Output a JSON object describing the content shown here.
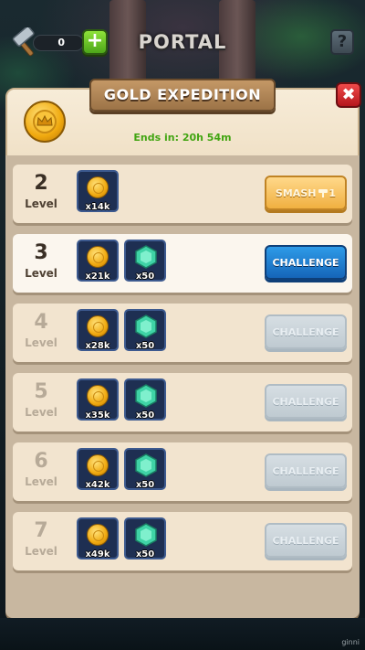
{
  "topbar": {
    "hammer_count": "0",
    "plus_label": "+",
    "title": "PORTAL",
    "help_label": "?"
  },
  "panel": {
    "title": "GOLD EXPEDITION",
    "close_label": "✖",
    "timer": "Ends in: 20h 54m"
  },
  "levels": [
    {
      "number": "2",
      "label": "Level",
      "rewards": [
        {
          "type": "coin",
          "amount": "x14k"
        }
      ],
      "button": "SMASH",
      "button_suffix": "1",
      "state": "completed"
    },
    {
      "number": "3",
      "label": "Level",
      "rewards": [
        {
          "type": "coin",
          "amount": "x21k"
        },
        {
          "type": "gem",
          "amount": "x50"
        }
      ],
      "button": "CHALLENGE",
      "state": "active"
    },
    {
      "number": "4",
      "label": "Level",
      "rewards": [
        {
          "type": "coin",
          "amount": "x28k"
        },
        {
          "type": "gem",
          "amount": "x50"
        }
      ],
      "button": "CHALLENGE",
      "state": "locked"
    },
    {
      "number": "5",
      "label": "Level",
      "rewards": [
        {
          "type": "coin",
          "amount": "x35k"
        },
        {
          "type": "gem",
          "amount": "x50"
        }
      ],
      "button": "CHALLENGE",
      "state": "locked"
    },
    {
      "number": "6",
      "label": "Level",
      "rewards": [
        {
          "type": "coin",
          "amount": "x42k"
        },
        {
          "type": "gem",
          "amount": "x50"
        }
      ],
      "button": "CHALLENGE",
      "state": "locked"
    },
    {
      "number": "7",
      "label": "Level",
      "rewards": [
        {
          "type": "coin",
          "amount": "x49k"
        },
        {
          "type": "gem",
          "amount": "x50"
        }
      ],
      "button": "CHALLENGE",
      "state": "locked"
    }
  ],
  "footer": {
    "tag": "ginni"
  },
  "colors": {
    "panel_bg": "#f3e6d1",
    "challenge_blue": "#1e7fd2",
    "smash_orange": "#f0b041",
    "timer_green": "#42a512",
    "close_red": "#d22a2f",
    "plus_green": "#5cbc1f"
  }
}
